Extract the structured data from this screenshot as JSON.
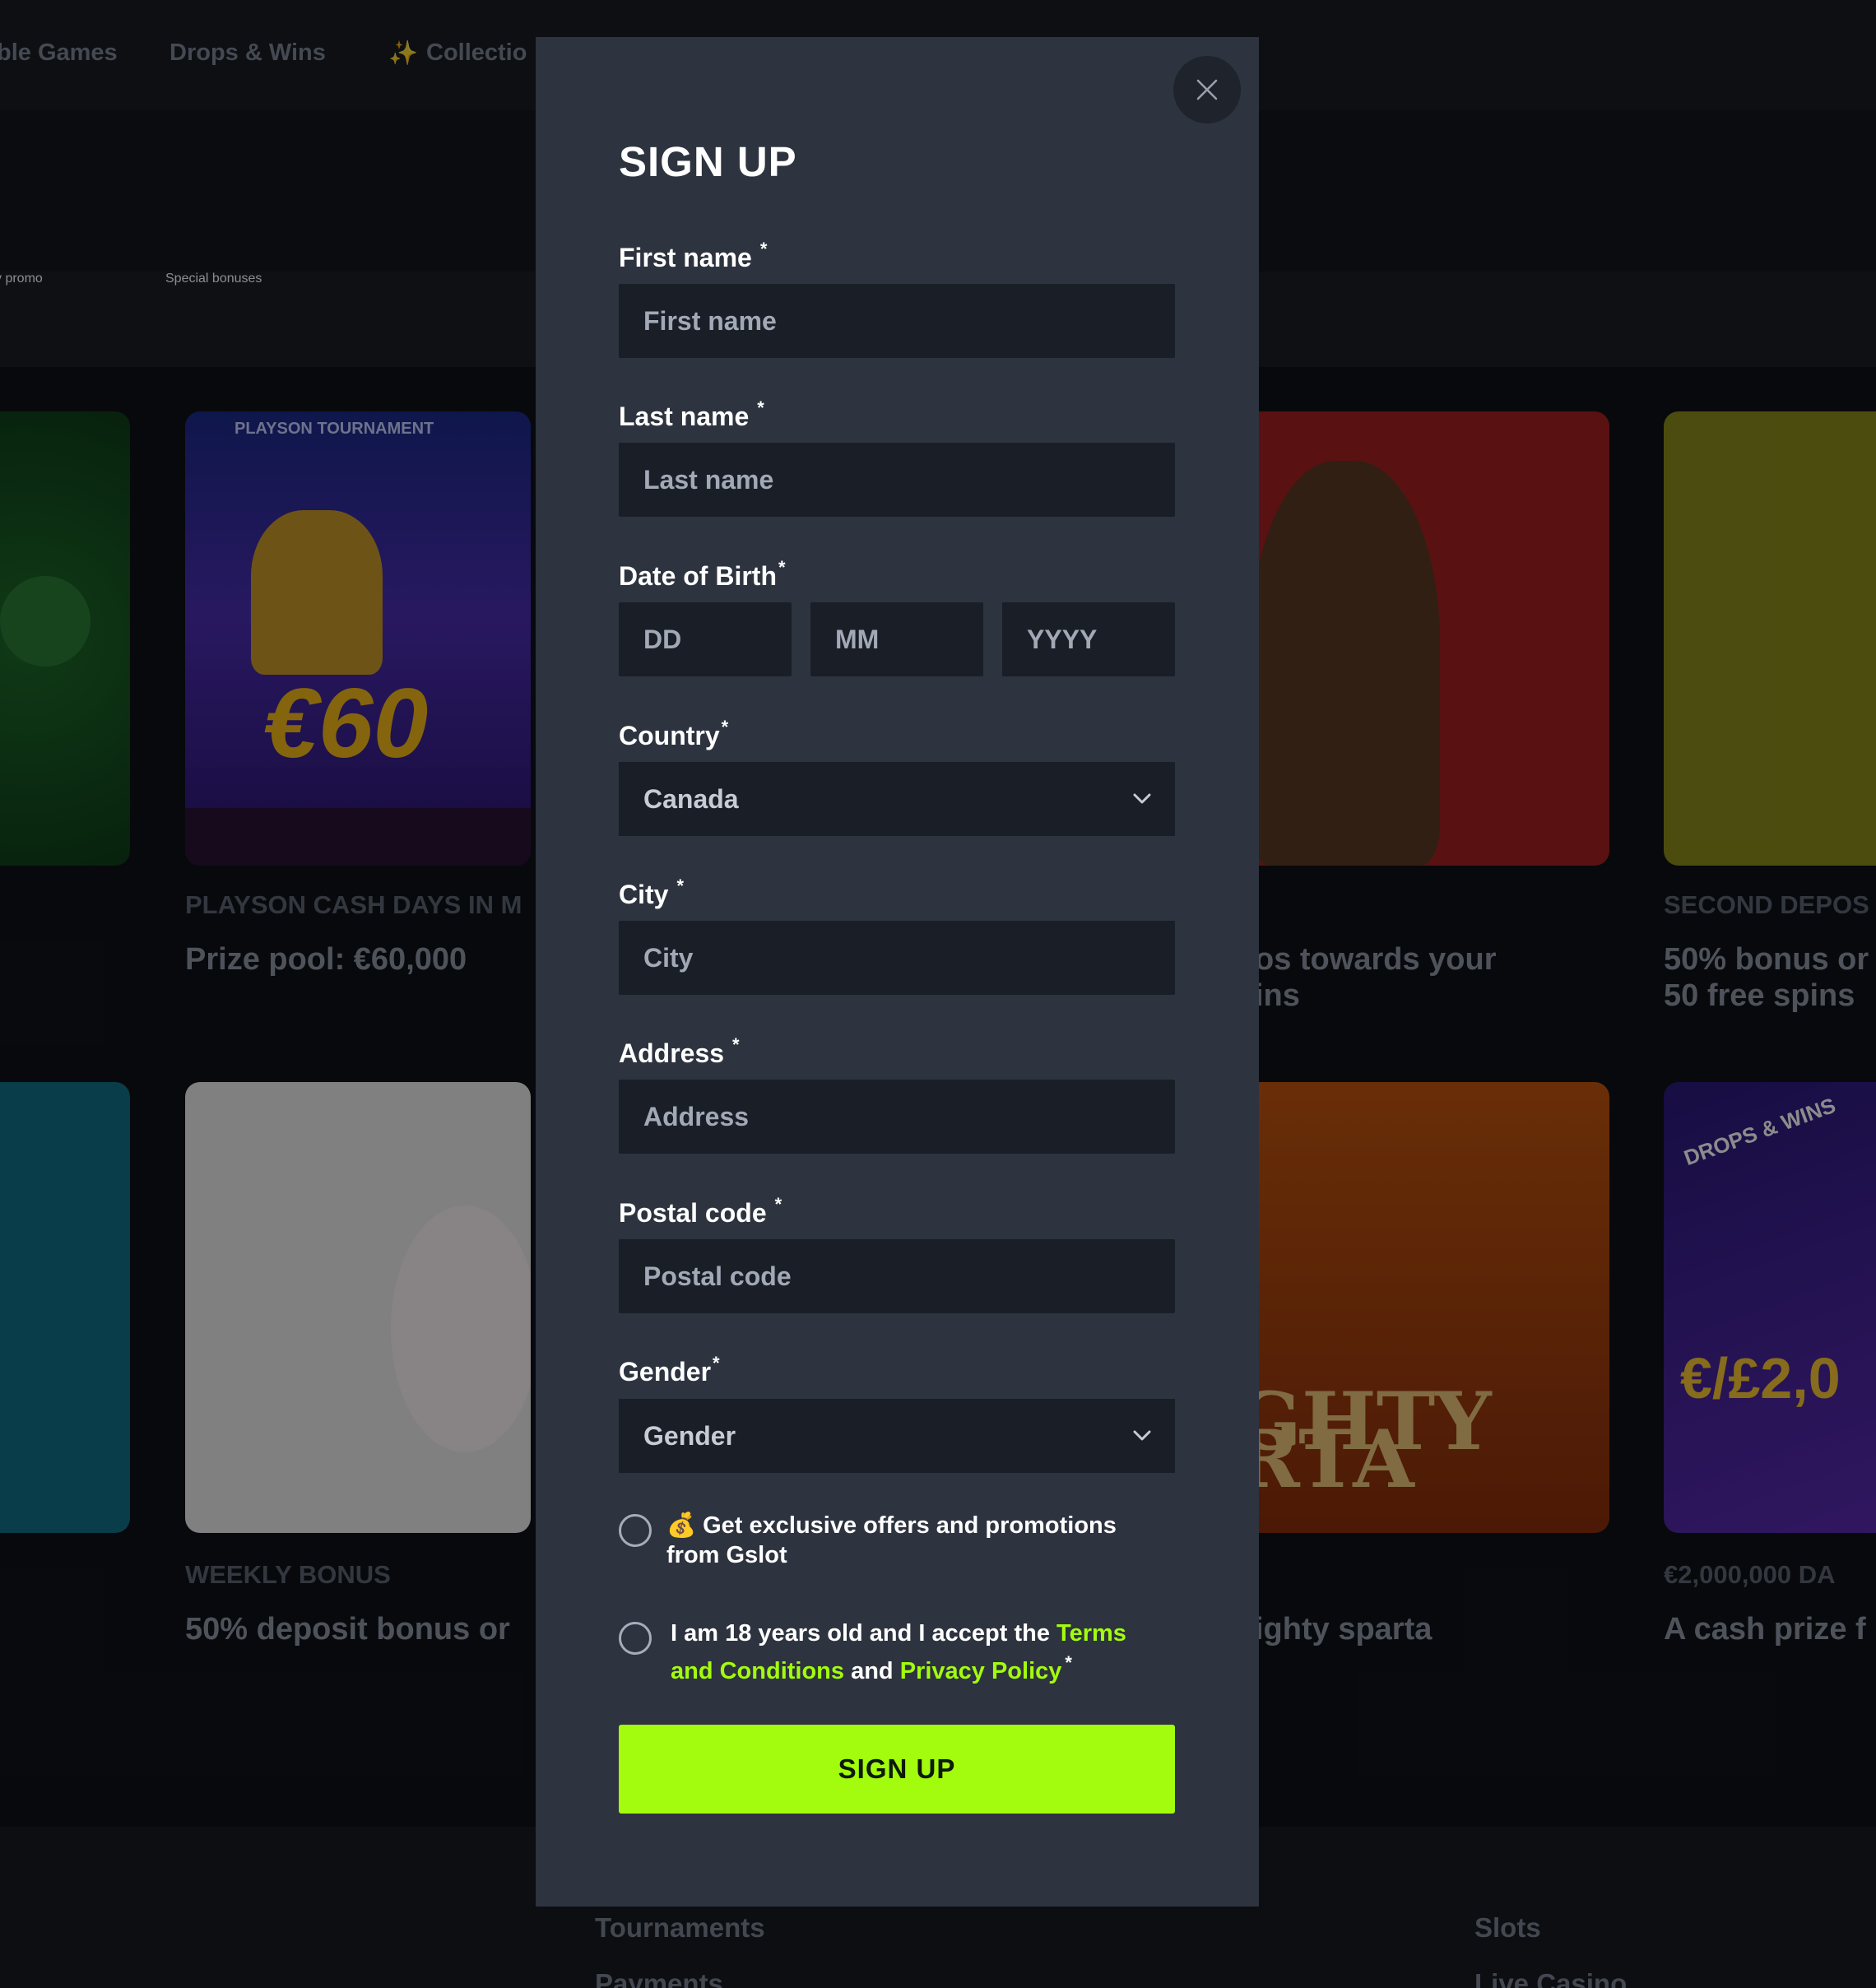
{
  "background": {
    "nav": [
      "ble Games",
      "Drops & Wins",
      "Collectio"
    ],
    "promo_tabs": [
      "y promo",
      "Special bonuses"
    ],
    "cards_row1": [
      {
        "caption": "PLAYSON CASH DAYS IN M",
        "title": "Prize pool: €60,000"
      },
      {
        "caption": "",
        "title": "os towards your\nins"
      },
      {
        "caption": "SECOND DEPOS",
        "title": "50% bonus or\n50 free spins"
      }
    ],
    "cards_row2": [
      {
        "caption": "WEEKLY BONUS",
        "title": "50% deposit bonus or"
      },
      {
        "caption": "",
        "title": "ighty sparta"
      },
      {
        "caption": "€2,000,000 DA",
        "title": "A cash prize f"
      }
    ],
    "card_art": {
      "cash_days": "CASH DAYS €60",
      "sparta": "GHTY RTA",
      "drops": "DROPS & WINS",
      "drops_amount": "€/£2,0",
      "tournament": "PLAYSON TOURNAMENT"
    },
    "footer": [
      "Tournaments",
      "Payments",
      "Slots",
      "Live Casino"
    ]
  },
  "modal": {
    "title": "SIGN UP",
    "close_icon": "close-icon",
    "fields": {
      "first_name": {
        "label": "First name",
        "placeholder": "First name",
        "value": ""
      },
      "last_name": {
        "label": "Last name",
        "placeholder": "Last name",
        "value": ""
      },
      "dob": {
        "label": "Date of Birth",
        "day_placeholder": "DD",
        "month_placeholder": "MM",
        "year_placeholder": "YYYY"
      },
      "country": {
        "label": "Country",
        "value": "Canada"
      },
      "city": {
        "label": "City",
        "placeholder": "City",
        "value": ""
      },
      "address": {
        "label": "Address",
        "placeholder": "Address",
        "value": ""
      },
      "postal_code": {
        "label": "Postal code",
        "placeholder": "Postal code",
        "value": ""
      },
      "gender": {
        "label": "Gender",
        "value": "Gender"
      }
    },
    "required_mark": "*",
    "offers_check": {
      "emoji": "💰",
      "text": "Get exclusive offers and promotions from Gslot",
      "checked": false
    },
    "terms_check": {
      "text_before": "I am 18 years old and I accept the ",
      "terms_link": "Terms and Conditions",
      "text_middle": " and ",
      "privacy_link": "Privacy Policy",
      "checked": false
    },
    "submit_label": "SIGN UP",
    "accent_color": "#a3fb0e"
  }
}
